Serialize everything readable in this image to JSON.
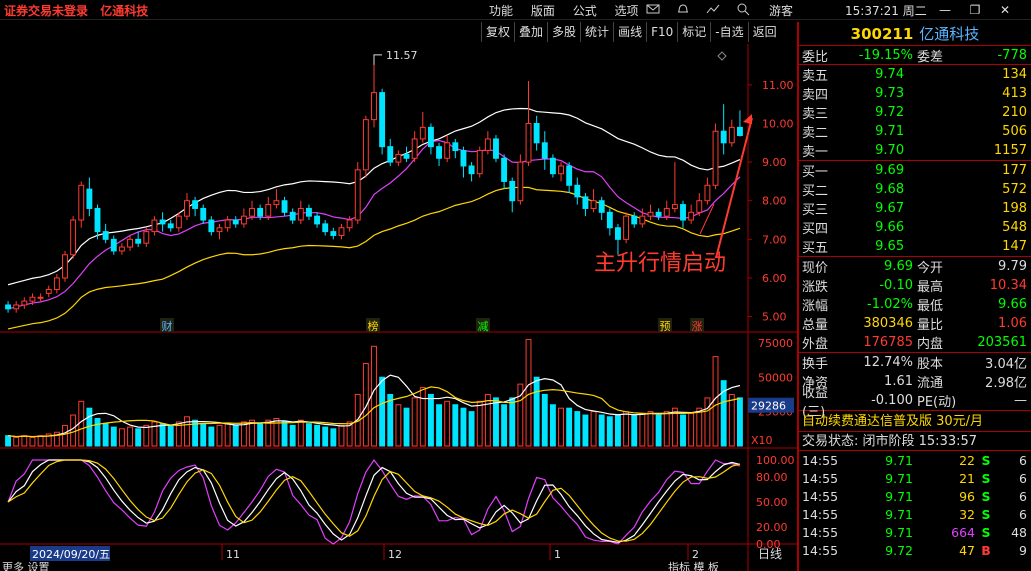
{
  "topbar": {
    "status": "证券交易未登录",
    "stock_name": "亿通科技",
    "menu": [
      "功能",
      "版面",
      "公式",
      "选项"
    ],
    "guest": "游客",
    "clock": "15:37:21 周二"
  },
  "toolbar": [
    "复权",
    "叠加",
    "多股",
    "统计",
    "画线",
    "F10",
    "标记",
    "-自选",
    "返回"
  ],
  "chart": {
    "max_label": "11.57",
    "annotation": "主升行情启动",
    "price_axis": [
      "11.00",
      "10.00",
      "9.00",
      "8.00",
      "7.00",
      "6.00",
      "5.00"
    ],
    "events": [
      {
        "label": "财",
        "color": "#5ab3ff"
      },
      {
        "label": "榜",
        "color": "#ffd700"
      },
      {
        "label": "减",
        "color": "#0f0"
      },
      {
        "label": "预",
        "color": "#ffd700"
      },
      {
        "label": "涨",
        "color": "#ff3b30"
      }
    ],
    "vol_axis": [
      "75000",
      "50000",
      "25000"
    ],
    "vol_tag": "29286",
    "vol_unit": "X10",
    "osc_axis": [
      "100.00",
      "80.00",
      "50.00",
      "20.00",
      "0.00"
    ],
    "date_tag": "2024/09/20/五",
    "months": [
      "11",
      "12",
      "1",
      "2"
    ],
    "period": "日线",
    "bottom_left": "更多 设置",
    "bottom_right": "指标 模 板"
  },
  "quote": {
    "code": "300211",
    "name": "亿通科技",
    "weibi_label": "委比",
    "weibi": "-19.15%",
    "weicha_label": "委差",
    "weicha": "-778",
    "asks": [
      {
        "label": "卖五",
        "price": "9.74",
        "vol": "134"
      },
      {
        "label": "卖四",
        "price": "9.73",
        "vol": "413"
      },
      {
        "label": "卖三",
        "price": "9.72",
        "vol": "210"
      },
      {
        "label": "卖二",
        "price": "9.71",
        "vol": "506"
      },
      {
        "label": "卖一",
        "price": "9.70",
        "vol": "1157"
      }
    ],
    "bids": [
      {
        "label": "买一",
        "price": "9.69",
        "vol": "177"
      },
      {
        "label": "买二",
        "price": "9.68",
        "vol": "572"
      },
      {
        "label": "买三",
        "price": "9.67",
        "vol": "198"
      },
      {
        "label": "买四",
        "price": "9.66",
        "vol": "548"
      },
      {
        "label": "买五",
        "price": "9.65",
        "vol": "147"
      }
    ],
    "stats": [
      {
        "l1": "现价",
        "v1": "9.69",
        "c1": "green",
        "l2": "今开",
        "v2": "9.79",
        "c2": "white"
      },
      {
        "l1": "涨跌",
        "v1": "-0.10",
        "c1": "green",
        "l2": "最高",
        "v2": "10.34",
        "c2": "red"
      },
      {
        "l1": "涨幅",
        "v1": "-1.02%",
        "c1": "green",
        "l2": "最低",
        "v2": "9.66",
        "c2": "green"
      },
      {
        "l1": "总量",
        "v1": "380346",
        "c1": "yellow",
        "l2": "量比",
        "v2": "1.06",
        "c2": "red"
      },
      {
        "l1": "外盘",
        "v1": "176785",
        "c1": "red",
        "l2": "内盘",
        "v2": "203561",
        "c2": "green"
      }
    ],
    "stats2": [
      {
        "l1": "换手",
        "v1": "12.74%",
        "l2": "股本",
        "v2": "3.04亿"
      },
      {
        "l1": "净资",
        "v1": "1.61",
        "l2": "流通",
        "v2": "2.98亿"
      },
      {
        "l1": "收益(三)",
        "v1": "-0.100",
        "l2": "PE(动)",
        "v2": "—"
      }
    ],
    "ad": "自动续费通达信普及版  30元/月",
    "status": "交易状态: 闭市阶段 15:33:57",
    "ticks": [
      {
        "time": "14:55",
        "price": "9.71",
        "vol": "22",
        "dir": "S",
        "n": "6"
      },
      {
        "time": "14:55",
        "price": "9.71",
        "vol": "21",
        "dir": "S",
        "n": "6"
      },
      {
        "time": "14:55",
        "price": "9.71",
        "vol": "96",
        "dir": "S",
        "n": "6"
      },
      {
        "time": "14:55",
        "price": "9.71",
        "vol": "32",
        "dir": "S",
        "n": "6"
      },
      {
        "time": "14:55",
        "price": "9.71",
        "vol": "664",
        "dir": "S",
        "n": "48"
      },
      {
        "time": "14:55",
        "price": "9.72",
        "vol": "47",
        "dir": "B",
        "n": "9"
      }
    ]
  },
  "chart_data": {
    "type": "candlestick",
    "price_ylim": [
      4.6,
      11.8
    ],
    "candles": [
      [
        5.3,
        5.2,
        5.4,
        5.1
      ],
      [
        5.2,
        5.3,
        5.4,
        5.1
      ],
      [
        5.3,
        5.4,
        5.5,
        5.2
      ],
      [
        5.4,
        5.5,
        5.6,
        5.3
      ],
      [
        5.5,
        5.5,
        5.6,
        5.4
      ],
      [
        5.6,
        5.7,
        5.8,
        5.5
      ],
      [
        5.7,
        6.0,
        6.1,
        5.6
      ],
      [
        6.0,
        6.6,
        6.7,
        5.9
      ],
      [
        6.6,
        7.5,
        7.6,
        6.5
      ],
      [
        7.5,
        8.4,
        8.5,
        7.3
      ],
      [
        8.3,
        7.8,
        8.6,
        7.6
      ],
      [
        7.8,
        7.2,
        7.9,
        7.0
      ],
      [
        7.2,
        7.0,
        7.4,
        6.9
      ],
      [
        7.0,
        6.7,
        7.1,
        6.6
      ],
      [
        6.7,
        6.8,
        6.9,
        6.6
      ],
      [
        6.8,
        7.0,
        7.1,
        6.7
      ],
      [
        7.0,
        6.9,
        7.2,
        6.8
      ],
      [
        6.9,
        7.2,
        7.3,
        6.8
      ],
      [
        7.2,
        7.5,
        7.6,
        7.1
      ],
      [
        7.5,
        7.4,
        7.7,
        7.2
      ],
      [
        7.4,
        7.3,
        7.5,
        7.2
      ],
      [
        7.3,
        7.6,
        7.7,
        7.2
      ],
      [
        7.6,
        8.0,
        8.2,
        7.5
      ],
      [
        8.0,
        7.8,
        8.1,
        7.6
      ],
      [
        7.8,
        7.5,
        7.9,
        7.4
      ],
      [
        7.5,
        7.2,
        7.6,
        7.1
      ],
      [
        7.2,
        7.3,
        7.4,
        7.0
      ],
      [
        7.3,
        7.5,
        7.6,
        7.2
      ],
      [
        7.5,
        7.4,
        7.6,
        7.3
      ],
      [
        7.4,
        7.6,
        7.8,
        7.3
      ],
      [
        7.6,
        7.8,
        8.0,
        7.5
      ],
      [
        7.8,
        7.6,
        7.9,
        7.5
      ],
      [
        7.6,
        7.9,
        8.1,
        7.5
      ],
      [
        7.9,
        8.0,
        8.3,
        7.8
      ],
      [
        8.0,
        7.7,
        8.1,
        7.6
      ],
      [
        7.7,
        7.5,
        7.8,
        7.4
      ],
      [
        7.5,
        7.8,
        8.0,
        7.4
      ],
      [
        7.8,
        7.6,
        7.9,
        7.5
      ],
      [
        7.6,
        7.4,
        7.7,
        7.3
      ],
      [
        7.4,
        7.2,
        7.5,
        7.1
      ],
      [
        7.2,
        7.1,
        7.3,
        7.0
      ],
      [
        7.1,
        7.3,
        7.4,
        7.0
      ],
      [
        7.3,
        7.5,
        7.6,
        7.2
      ],
      [
        7.5,
        8.8,
        9.0,
        7.4
      ],
      [
        8.8,
        10.1,
        10.2,
        8.6
      ],
      [
        10.1,
        10.8,
        11.57,
        9.9
      ],
      [
        10.8,
        9.4,
        10.9,
        9.2
      ],
      [
        9.4,
        9.0,
        9.6,
        8.9
      ],
      [
        9.0,
        9.2,
        9.3,
        8.9
      ],
      [
        9.2,
        9.1,
        9.4,
        9.0
      ],
      [
        9.1,
        9.6,
        9.8,
        9.0
      ],
      [
        9.6,
        9.9,
        10.3,
        9.5
      ],
      [
        9.9,
        9.4,
        10.0,
        9.2
      ],
      [
        9.4,
        9.1,
        9.5,
        8.9
      ],
      [
        9.1,
        9.5,
        9.7,
        9.0
      ],
      [
        9.5,
        9.3,
        9.6,
        9.1
      ],
      [
        9.3,
        8.9,
        9.4,
        8.6
      ],
      [
        8.9,
        8.7,
        9.0,
        8.5
      ],
      [
        8.7,
        9.3,
        9.4,
        8.6
      ],
      [
        9.3,
        9.6,
        9.8,
        9.2
      ],
      [
        9.6,
        9.1,
        9.7,
        9.0
      ],
      [
        9.1,
        8.5,
        9.2,
        8.3
      ],
      [
        8.5,
        8.0,
        8.6,
        7.7
      ],
      [
        8.0,
        9.0,
        9.2,
        7.9
      ],
      [
        9.0,
        10.0,
        11.1,
        8.9
      ],
      [
        10.0,
        9.5,
        10.2,
        9.3
      ],
      [
        9.5,
        9.1,
        9.8,
        8.8
      ],
      [
        9.1,
        8.7,
        9.2,
        8.6
      ],
      [
        8.7,
        8.9,
        9.0,
        8.5
      ],
      [
        8.9,
        8.4,
        9.0,
        8.2
      ],
      [
        8.4,
        8.1,
        8.6,
        7.9
      ],
      [
        8.1,
        7.8,
        8.2,
        7.6
      ],
      [
        7.8,
        8.0,
        8.3,
        7.7
      ],
      [
        8.0,
        7.7,
        8.1,
        7.5
      ],
      [
        7.7,
        7.3,
        7.8,
        7.1
      ],
      [
        7.3,
        7.0,
        7.4,
        6.6
      ],
      [
        7.0,
        7.6,
        7.7,
        6.9
      ],
      [
        7.6,
        7.4,
        7.7,
        7.3
      ],
      [
        7.4,
        7.6,
        7.8,
        7.3
      ],
      [
        7.6,
        7.7,
        7.9,
        7.5
      ],
      [
        7.7,
        7.6,
        7.8,
        7.5
      ],
      [
        7.6,
        7.8,
        8.0,
        7.5
      ],
      [
        7.8,
        7.9,
        9.0,
        7.7
      ],
      [
        7.9,
        7.5,
        8.0,
        7.3
      ],
      [
        7.5,
        7.7,
        7.9,
        7.4
      ],
      [
        7.7,
        8.0,
        8.2,
        7.6
      ],
      [
        8.0,
        8.4,
        8.6,
        7.9
      ],
      [
        8.4,
        9.8,
        10.0,
        8.3
      ],
      [
        9.8,
        9.5,
        10.5,
        9.2
      ],
      [
        9.5,
        9.9,
        10.1,
        9.4
      ],
      [
        9.9,
        9.69,
        10.34,
        9.66
      ]
    ],
    "volume": [
      6,
      5,
      6,
      5,
      6,
      7,
      8,
      12,
      18,
      26,
      22,
      16,
      13,
      11,
      10,
      11,
      10,
      12,
      14,
      13,
      12,
      14,
      17,
      15,
      13,
      11,
      12,
      13,
      12,
      14,
      15,
      13,
      15,
      16,
      14,
      12,
      15,
      13,
      12,
      11,
      10,
      12,
      14,
      30,
      48,
      58,
      40,
      30,
      24,
      22,
      28,
      34,
      30,
      24,
      26,
      24,
      22,
      20,
      26,
      30,
      28,
      24,
      28,
      36,
      62,
      40,
      30,
      24,
      22,
      22,
      20,
      18,
      20,
      18,
      17,
      18,
      20,
      18,
      19,
      20,
      18,
      20,
      22,
      18,
      19,
      22,
      28,
      52,
      38,
      30,
      28
    ],
    "vol_ylim": [
      0,
      80000
    ]
  }
}
